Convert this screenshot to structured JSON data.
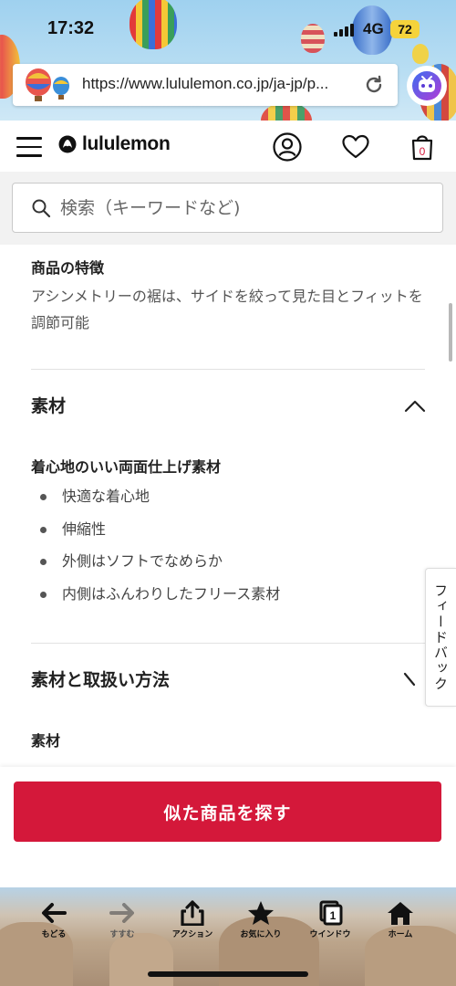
{
  "status_bar": {
    "time": "17:32",
    "network": "4G",
    "battery": "72"
  },
  "browser": {
    "url": "https://www.lululemon.co.jp/ja-jp/p...",
    "reload_icon": "reload-icon",
    "assistant_icon": "assistant-bot-icon"
  },
  "header": {
    "logo_text": "lululemon",
    "menu_icon": "hamburger-icon",
    "account_icon": "account-icon",
    "wishlist_icon": "heart-icon",
    "bag_icon": "bag-icon",
    "bag_count": "0"
  },
  "search": {
    "placeholder": "検索（キーワードなど)"
  },
  "features": {
    "title": "商品の特徴",
    "text": "アシンメトリーの裾は、サイドを絞って見た目とフィットを調節可能"
  },
  "material_section": {
    "title": "素材",
    "expanded": true,
    "subtitle": "着心地のいい両面仕上げ素材",
    "bullets": [
      "快適な着心地",
      "伸縮性",
      "外側はソフトでなめらか",
      "内側はふんわりしたフリース素材"
    ]
  },
  "care_section": {
    "title": "素材と取扱い方法",
    "subtitle": "素材"
  },
  "feedback": {
    "label": "フィードバック"
  },
  "cta": {
    "label": "似た商品を探す"
  },
  "toolbar": {
    "back": "もどる",
    "forward": "すすむ",
    "action": "アクション",
    "favorites": "お気に入り",
    "window": "ウインドウ",
    "window_count": "1",
    "home": "ホーム"
  },
  "colors": {
    "accent": "#d4183a",
    "battery": "#f5d33b"
  }
}
